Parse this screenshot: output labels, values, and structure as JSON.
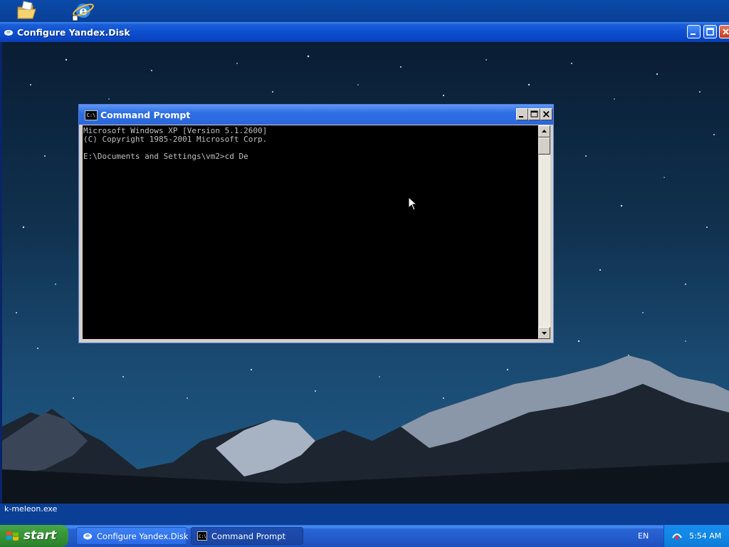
{
  "desktop": {
    "icons": [
      "folder-icon",
      "internet-explorer-icon"
    ]
  },
  "outer_window": {
    "title": "Configure Yandex.Disk"
  },
  "cmd_window": {
    "title": "Command Prompt",
    "icon_text": "C:\\",
    "console_lines": [
      "Microsoft Windows XP [Version 5.1.2600]",
      "(C) Copyright 1985-2001 Microsoft Corp.",
      "",
      "E:\\Documents and Settings\\vm2>cd De"
    ]
  },
  "statusbar": {
    "text": "k-meleon.exe"
  },
  "taskbar": {
    "start_label": "start",
    "tasks": [
      {
        "label": "Configure Yandex.Disk",
        "icon": "yandex-disk-icon"
      },
      {
        "label": "Command Prompt",
        "icon": "cmd-icon"
      }
    ],
    "language": "EN",
    "clock": "5:54 AM"
  },
  "colors": {
    "taskbar": "#245ccd",
    "start_green": "#3c9a3c",
    "console_bg": "#000000",
    "console_fg": "#c0c0c0"
  }
}
